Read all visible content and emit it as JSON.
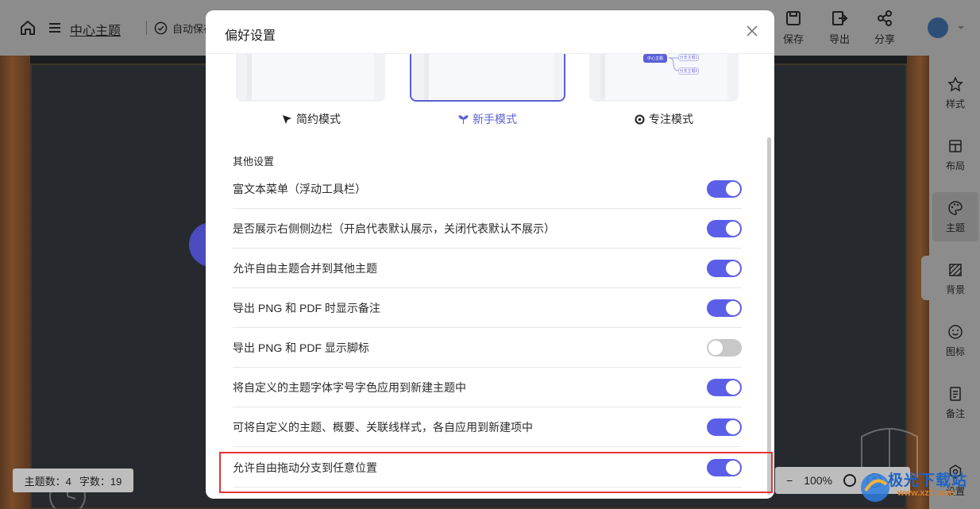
{
  "topbar": {
    "title": "中心主题",
    "autosave": "自动保存",
    "actions": [
      {
        "label": "保存",
        "icon": "floppy-icon"
      },
      {
        "label": "导出",
        "icon": "export-icon"
      },
      {
        "label": "分享",
        "icon": "share-icon"
      }
    ]
  },
  "statusbar": {
    "topics": "主题数：4",
    "words": "字数：19"
  },
  "zoom": {
    "minus": "−",
    "level": "100%",
    "help": "?"
  },
  "sidebar": {
    "items": [
      {
        "label": "样式",
        "icon": "style-icon"
      },
      {
        "label": "布局",
        "icon": "layout-icon"
      },
      {
        "label": "主题",
        "icon": "palette-icon",
        "active": true
      },
      {
        "label": "背景",
        "icon": "background-icon"
      },
      {
        "label": "图标",
        "icon": "emoji-icon"
      },
      {
        "label": "备注",
        "icon": "note-icon"
      },
      {
        "label": "设置",
        "icon": "settings-icon"
      }
    ]
  },
  "dialog": {
    "title": "偏好设置",
    "modes": [
      {
        "label": "简约模式",
        "icon": "pointer-icon",
        "active": false
      },
      {
        "label": "新手模式",
        "icon": "sprout-icon",
        "active": true
      },
      {
        "label": "专注模式",
        "icon": "focus-icon",
        "active": false
      }
    ],
    "preview_nodes": {
      "center": "中心主题",
      "branch1": "分支主题1",
      "branch2": "分支主题2"
    },
    "section_title": "其他设置",
    "settings": [
      {
        "label": "富文本菜单（浮动工具栏）",
        "enabled": true
      },
      {
        "label": "是否展示右侧侧边栏（开启代表默认展示，关闭代表默认不展示）",
        "enabled": true
      },
      {
        "label": "允许自由主题合并到其他主题",
        "enabled": true
      },
      {
        "label": "导出 PNG 和 PDF 时显示备注",
        "enabled": true
      },
      {
        "label": "导出 PNG 和 PDF 显示脚标",
        "enabled": false
      },
      {
        "label": "将自定义的主题字体字号字色应用到新建主题中",
        "enabled": true
      },
      {
        "label": "可将自定义的主题、概要、关联线样式，各自应用到新建项中",
        "enabled": true
      },
      {
        "label": "允许自由拖动分支到任意位置",
        "enabled": true
      }
    ]
  },
  "watermark": {
    "line1": "极光下载站",
    "line2": "www.xz7.com"
  },
  "colors": {
    "accent": "#5b5fe8",
    "highlight": "#e53535",
    "toggle_off": "#c8c8c8"
  }
}
